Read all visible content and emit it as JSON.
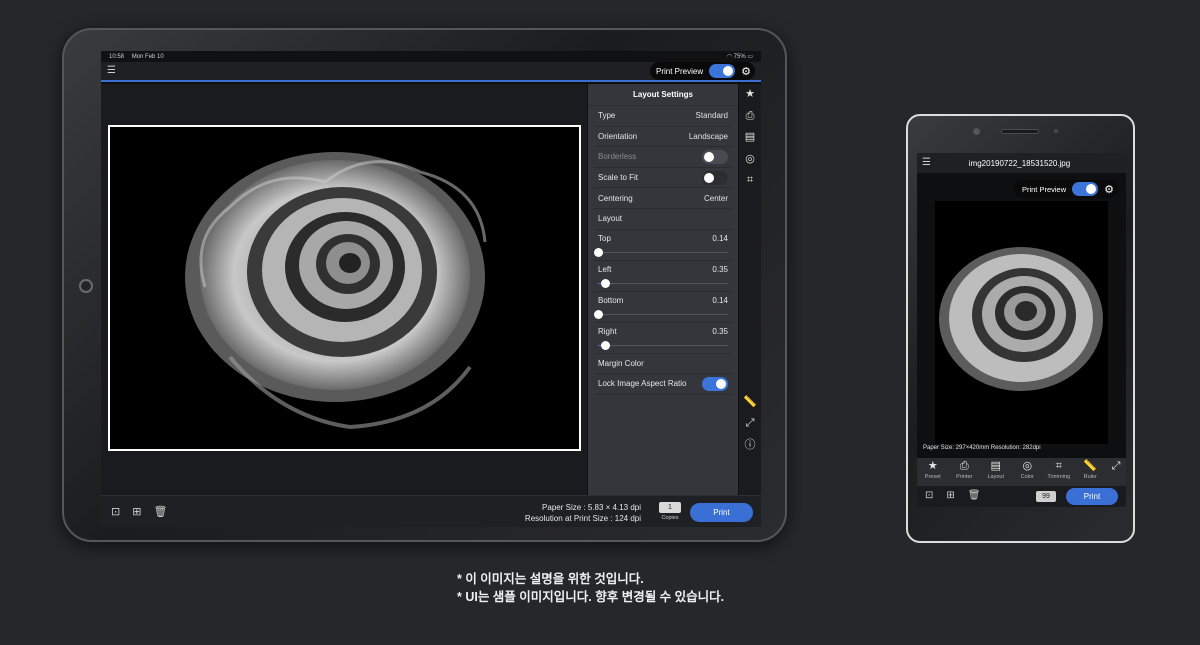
{
  "tablet": {
    "status": {
      "time": "10:58",
      "date": "Mon Feb 10",
      "battery": "75%"
    },
    "print_preview_label": "Print Preview",
    "panel": {
      "title": "Layout Settings",
      "rows": [
        {
          "label": "Type",
          "value": "Standard"
        },
        {
          "label": "Orientation",
          "value": "Landscape"
        },
        {
          "label": "Borderless",
          "value": ""
        },
        {
          "label": "Scale to Fit",
          "value": ""
        },
        {
          "label": "Centering",
          "value": "Center"
        },
        {
          "label": "Layout",
          "value": ""
        }
      ],
      "margins": [
        {
          "label": "Top",
          "value": "0.14"
        },
        {
          "label": "Left",
          "value": "0.35"
        },
        {
          "label": "Bottom",
          "value": "0.14"
        },
        {
          "label": "Right",
          "value": "0.35"
        }
      ],
      "margin_color_label": "Margin Color",
      "lock_label": "Lock Image Aspect Ratio"
    },
    "paper_size": "Paper Size : 5.83 × 4.13 dpi",
    "resolution": "Resolution at Print Size : 124 dpi",
    "copies_value": "1",
    "copies_label": "Copies",
    "print_label": "Print"
  },
  "phone": {
    "filename": "img20190722_18531520.jpg",
    "print_preview_label": "Print Preview",
    "info": "Paper Size: 297×420mm   Resolution: 282dpi",
    "tools": [
      {
        "icon": "star-icon",
        "label": "Preset"
      },
      {
        "icon": "printer-icon",
        "label": "Printer"
      },
      {
        "icon": "layout-icon",
        "label": "Layout"
      },
      {
        "icon": "color-icon",
        "label": "Color"
      },
      {
        "icon": "crop-icon",
        "label": "Trimming"
      },
      {
        "icon": "ruler-icon",
        "label": "Ruler"
      }
    ],
    "copies_value": "99",
    "print_label": "Print"
  },
  "caption": {
    "line1": "* 이 이미지는 설명을 위한 것입니다.",
    "line2": "* UI는 샘플 이미지입니다. 향후 변경될 수 있습니다."
  }
}
